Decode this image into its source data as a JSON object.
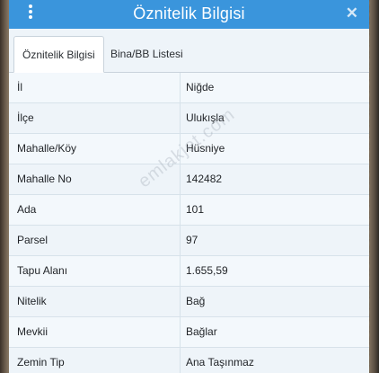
{
  "window": {
    "title": "Öznitelik Bilgisi",
    "close_glyph": "✕"
  },
  "tabs": [
    {
      "label": "Öznitelik Bilgisi",
      "active": true
    },
    {
      "label": "Bina/BB Listesi",
      "active": false
    }
  ],
  "rows": [
    {
      "key": "İl",
      "value": "Niğde"
    },
    {
      "key": "İlçe",
      "value": "Ulukışla"
    },
    {
      "key": "Mahalle/Köy",
      "value": "Hüsniye"
    },
    {
      "key": "Mahalle No",
      "value": "142482"
    },
    {
      "key": "Ada",
      "value": "101"
    },
    {
      "key": "Parsel",
      "value": "97"
    },
    {
      "key": "Tapu Alanı",
      "value": "1.655,59"
    },
    {
      "key": "Nitelik",
      "value": "Bağ"
    },
    {
      "key": "Mevkii",
      "value": "Bağlar"
    },
    {
      "key": "Zemin Tip",
      "value": "Ana Taşınmaz"
    }
  ],
  "watermark": "emlakjet.com",
  "icons": {
    "menu": "vertical-dots-icon",
    "close": "close-icon"
  },
  "colors": {
    "titlebar": "#3a95dc",
    "panel": "#eef4f9"
  }
}
